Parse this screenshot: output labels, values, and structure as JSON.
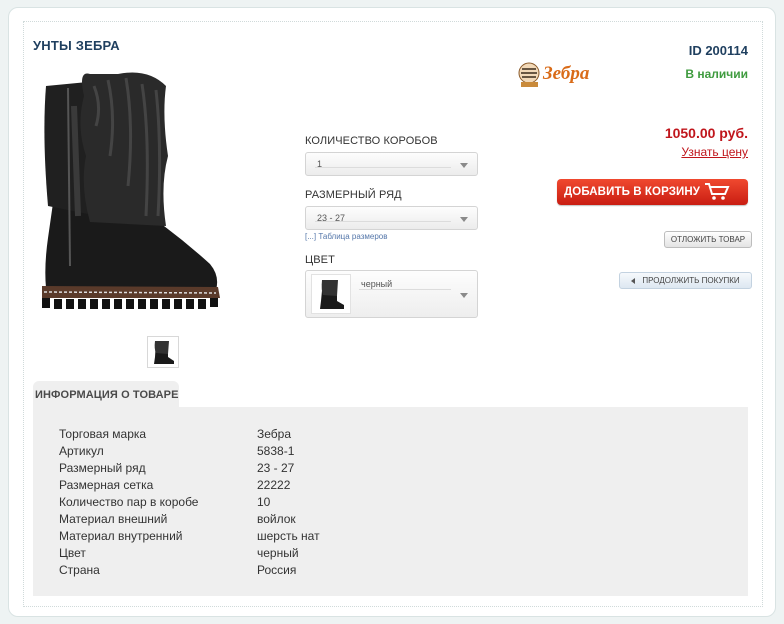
{
  "product": {
    "title": "УНТЫ ЗЕБРА",
    "id_label": "ID 200114",
    "brand_logo_text": "Зебра",
    "availability": "В наличии",
    "price": "1050.00 руб.",
    "price_link": "Узнать цену"
  },
  "options": {
    "boxes_label": "КОЛИЧЕСТВО КОРОБОВ",
    "boxes_value": "1",
    "size_range_label": "РАЗМЕРНЫЙ РЯД",
    "size_range_value": "23 - 27",
    "size_table_link": "[...] Таблица размеров",
    "color_label": "ЦВЕТ",
    "color_value": "черный"
  },
  "actions": {
    "add_to_cart": "ДОБАВИТЬ В КОРЗИНУ",
    "postpone": "ОТЛОЖИТЬ ТОВАР",
    "continue_shopping": "ПРОДОЛЖИТЬ ПОКУПКИ"
  },
  "info": {
    "tab_label": "ИНФОРМАЦИЯ О ТОВАРЕ",
    "rows": [
      {
        "key": "Торговая марка",
        "value": "Зебра"
      },
      {
        "key": "Артикул",
        "value": "5838-1"
      },
      {
        "key": "Размерный ряд",
        "value": "23 - 27"
      },
      {
        "key": "Размерная сетка",
        "value": "22222"
      },
      {
        "key": "Количество пар в коробе",
        "value": "10"
      },
      {
        "key": "Материал внешний",
        "value": "войлок"
      },
      {
        "key": "Материал внутренний",
        "value": "шерсть нат"
      },
      {
        "key": "Цвет",
        "value": "черный"
      },
      {
        "key": "Страна",
        "value": "Россия"
      }
    ]
  },
  "colors": {
    "title": "#1f3f5f",
    "price": "#c0151b",
    "stock": "#3f9b3f",
    "cart_button": "#d8271a"
  },
  "icons": {
    "cart": "shopping-cart-icon",
    "continue": "chevron-left-icon",
    "dropdown": "chevron-down-icon"
  }
}
